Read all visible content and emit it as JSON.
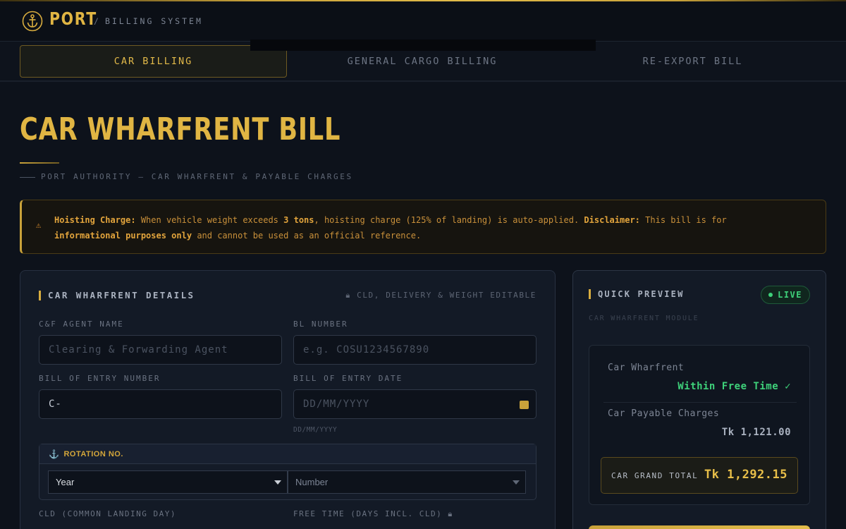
{
  "header": {
    "brand": "PORT",
    "breadcrumb_sep": "/",
    "breadcrumb": "BILLING SYSTEM"
  },
  "tabs": [
    {
      "label": "CAR BILLING",
      "active": true
    },
    {
      "label": "GENERAL CARGO BILLING",
      "active": false
    },
    {
      "label": "RE-EXPORT BILL",
      "active": false
    }
  ],
  "page": {
    "title": "CAR WHARFRENT BILL",
    "subtitle": "PORT AUTHORITY — CAR WHARFRENT & PAYABLE CHARGES"
  },
  "alert": {
    "icon": "warning-icon",
    "hoisting_label": "Hoisting Charge:",
    "text1": "When vehicle weight exceeds",
    "weight": "3 tons",
    "text2": ", hoisting charge (125% of landing) is auto-applied.",
    "disclaimer_label": "Disclaimer:",
    "text3": "This bill is for",
    "informational": "informational purposes only",
    "text4": "and cannot be used as an official reference."
  },
  "form": {
    "title": "CAR WHARFRENT DETAILS",
    "note": "CLD, DELIVERY & WEIGHT EDITABLE",
    "cnf_label": "C&F AGENT NAME",
    "cnf_placeholder": "Clearing & Forwarding Agent",
    "bl_label": "BL NUMBER",
    "bl_placeholder": "e.g. COSU1234567890",
    "boe_label": "BILL OF ENTRY NUMBER",
    "boe_value": "C-",
    "boe_date_label": "BILL OF ENTRY DATE",
    "boe_date_placeholder": "DD/MM/YYYY",
    "boe_date_hint": "DD/MM/YYYY",
    "rotation": {
      "title": "ROTATION NO.",
      "year_value": "Year",
      "number_value": "Number"
    },
    "cld_label": "CLD (COMMON LANDING DAY)",
    "free_time_label": "FREE TIME (DAYS INCL. CLD)"
  },
  "preview": {
    "title": "QUICK PREVIEW",
    "live": "LIVE",
    "module": "CAR WHARFRENT MODULE",
    "wharfrent_label": "Car Wharfrent",
    "wharfrent_value": "Within Free Time ✓",
    "payable_label": "Car Payable Charges",
    "payable_value": "Tk 1,121.00",
    "grand_total_label": "CAR GRAND TOTAL",
    "grand_total_value": "Tk 1,292.15"
  },
  "colors": {
    "gold": "#e0b543",
    "green": "#3ed17a",
    "background": "#0d121b"
  }
}
